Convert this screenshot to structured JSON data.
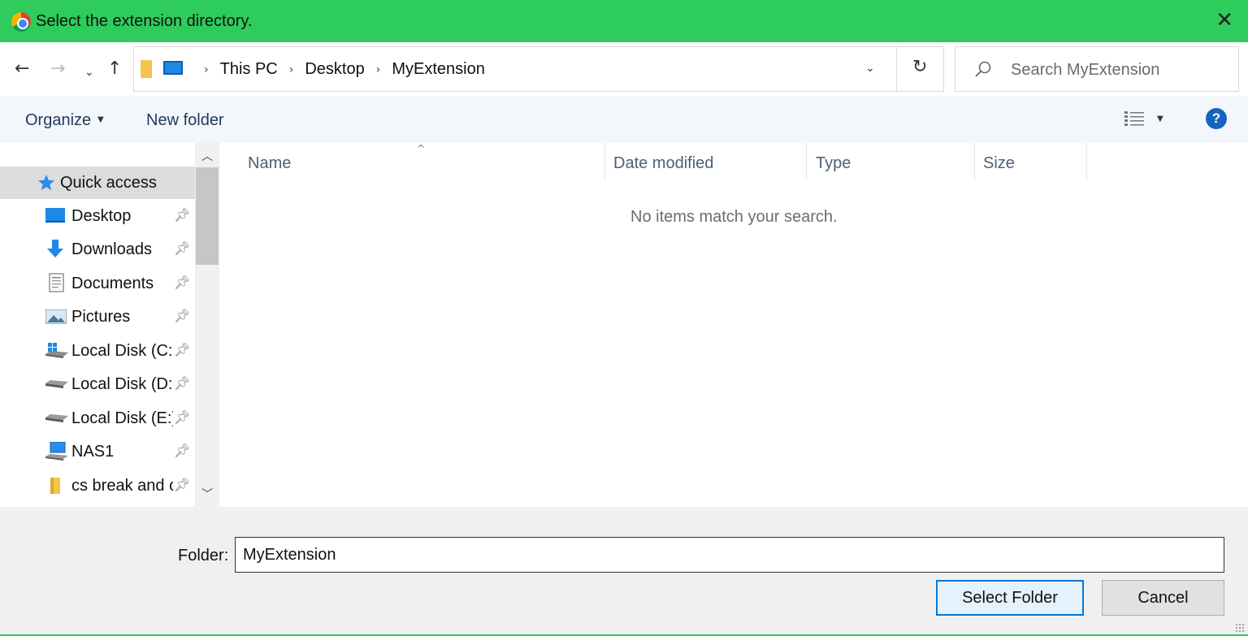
{
  "window": {
    "title": "Select the extension directory.",
    "app_icon": "chrome-icon",
    "close_icon": "close-icon",
    "accent_color": "#2ecc5c"
  },
  "nav": {
    "back_icon": "back-arrow-icon",
    "forward_icon": "forward-arrow-icon",
    "recent_icon": "chevron-down-icon",
    "up_icon": "up-arrow-icon"
  },
  "address": {
    "crumbs": [
      "This PC",
      "Desktop",
      "MyExtension"
    ],
    "refresh_icon": "refresh-icon"
  },
  "search": {
    "placeholder": "Search MyExtension"
  },
  "toolbar": {
    "organize_label": "Organize",
    "new_folder_label": "New folder",
    "help_label": "?"
  },
  "sidebar": {
    "items": [
      {
        "label": "Quick access",
        "icon": "star-icon"
      },
      {
        "label": "Desktop",
        "icon": "desktop-icon"
      },
      {
        "label": "Downloads",
        "icon": "download-icon"
      },
      {
        "label": "Documents",
        "icon": "documents-icon"
      },
      {
        "label": "Pictures",
        "icon": "pictures-icon"
      },
      {
        "label": "Local Disk (C:)",
        "icon": "windows-drive-icon"
      },
      {
        "label": "Local Disk (D:)",
        "icon": "drive-icon"
      },
      {
        "label": "Local Disk (E:)",
        "icon": "drive-icon"
      },
      {
        "label": "NAS1",
        "icon": "network-drive-icon"
      },
      {
        "label": "cs break and continue",
        "icon": "folder-icon"
      }
    ]
  },
  "list": {
    "columns": [
      "Name",
      "Date modified",
      "Type",
      "Size"
    ],
    "empty_message": "No items match your search."
  },
  "footer": {
    "folder_label": "Folder:",
    "folder_value": "MyExtension",
    "select_button": "Select Folder",
    "cancel_button": "Cancel"
  }
}
